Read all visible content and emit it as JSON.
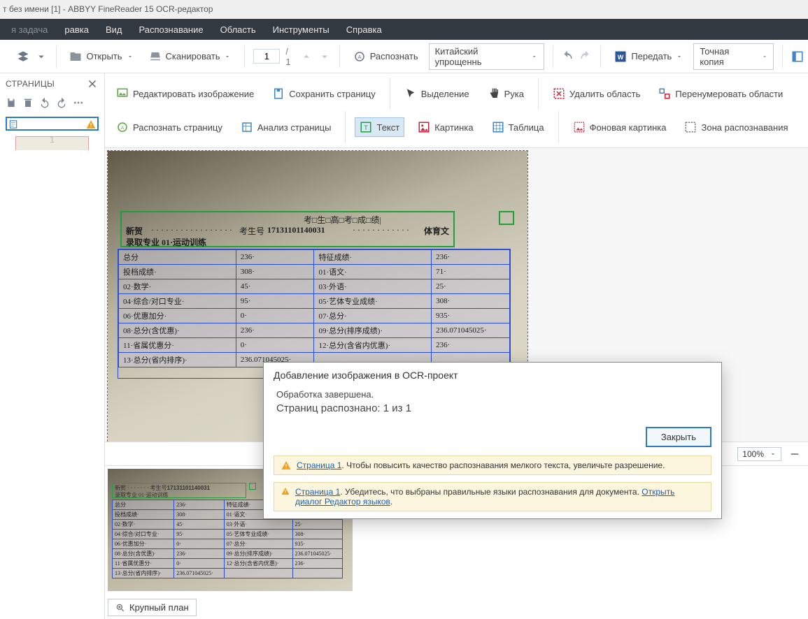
{
  "title": "т без имени [1] - ABBYY FineReader 15 OCR-редактор",
  "menu": {
    "items": [
      "равка",
      "Вид",
      "Распознавание",
      "Область",
      "Инструменты",
      "Справка"
    ],
    "disabled_first": "я задача"
  },
  "toolbar": {
    "open": "Открыть",
    "scan": "Сканировать",
    "page_cur": "1",
    "page_total": "/ 1",
    "recognize": "Распознать",
    "language": "Китайский упрощеннь",
    "send": "Передать",
    "layout": "Точная копия"
  },
  "sidebar": {
    "title": "СТРАНИЦЫ",
    "page_num": "1"
  },
  "sec_toolbar": {
    "edit_img": "Редактировать изображение",
    "save_page": "Сохранить страницу",
    "select": "Выделение",
    "hand": "Рука",
    "del_area": "Удалить область",
    "renumber": "Перенумеровать области",
    "rec_page": "Распознать страницу",
    "analyze": "Анализ страницы",
    "text": "Текст",
    "picture": "Картинка",
    "table": "Таблица",
    "bg_pic": "Фоновая картинка",
    "rec_zone": "Зона распознавания"
  },
  "doc": {
    "header_line1_a": "考□生□高□考□成□绩|",
    "header_line2_a": "新贺",
    "header_line2_b": "考生号",
    "header_line2_id": "17131101140031",
    "header_line2_c": "体育文",
    "header_line3": "录取专业 01·运动训练",
    "table": [
      [
        "总分",
        "236·",
        "特征成绩·",
        "236·"
      ],
      [
        "投档成绩·",
        "308·",
        "01·语文·",
        "71·"
      ],
      [
        "02·数学·",
        "45·",
        "03·外语·",
        "25·"
      ],
      [
        "04·综合/对口专业·",
        "95·",
        "05·艺体专业成绩·",
        "308·"
      ],
      [
        "06·优惠加分·",
        "0·",
        "07·总分·",
        "935·"
      ],
      [
        "08·总分(含优惠)·",
        "236·",
        "09·总分(排序成绩)·",
        "236.071045025·"
      ],
      [
        "11·省属优惠分·",
        "0·",
        "12·总分(含省内优惠)·",
        "236·"
      ],
      [
        "13·总分(省内排序)·",
        "236.071045025·",
        "",
        ""
      ]
    ]
  },
  "zoom": {
    "value": "100%"
  },
  "bigview": "Крупный план",
  "dialog": {
    "title": "Добавление изображения в OCR-проект",
    "done": "Обработка завершена.",
    "recognized": "Страниц распознано: 1 из 1",
    "close": "Закрыть",
    "w1_link": "Страница 1",
    "w1_text": ". Чтобы повысить качество распознавания мелкого текста, увеличьте разрешение.",
    "w2_link": "Страница 1",
    "w2_text": ". Убедитесь, что выбраны правильные языки распознавания для документа. ",
    "w2_link2": "Открыть диалог Редактор языков",
    "w2_tail": "."
  }
}
